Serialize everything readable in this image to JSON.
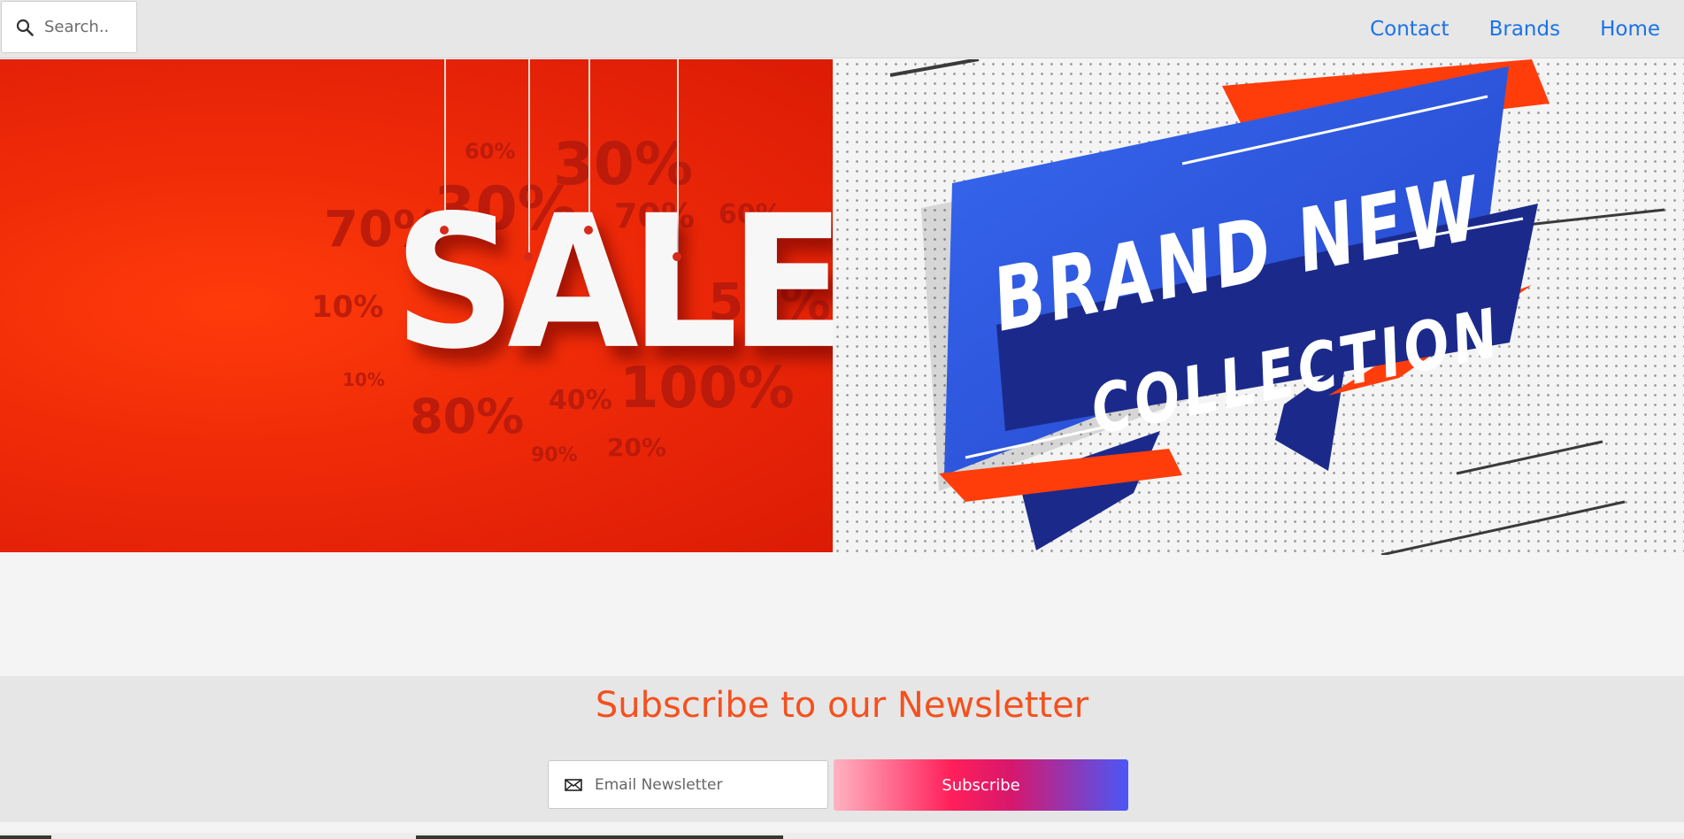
{
  "header": {
    "search": {
      "placeholder": "Search..",
      "icon": "search-icon"
    },
    "nav": [
      {
        "label": "Contact"
      },
      {
        "label": "Brands"
      },
      {
        "label": "Home"
      }
    ],
    "link_color": "#1a73e8"
  },
  "banners": {
    "sale": {
      "main_text": "SALE",
      "percent_labels": [
        "60%",
        "30%",
        "70%",
        "30%",
        "70%",
        "60%",
        "10%",
        "50%",
        "10%",
        "80%",
        "40%",
        "100%",
        "90%",
        "20%"
      ],
      "background_color": "#ee2a08"
    },
    "new_collection": {
      "line1": "BRAND NEW",
      "line2": "COLLECTION",
      "colors": {
        "blue": "#2e5be0",
        "navy": "#1b2a8a",
        "orange": "#ff3d0b"
      }
    }
  },
  "newsletter": {
    "title": "Subscribe to our Newsletter",
    "email_placeholder": "Email Newsletter",
    "email_icon": "envelope-icon",
    "button_label": "Subscribe",
    "title_color": "#f4511e"
  }
}
